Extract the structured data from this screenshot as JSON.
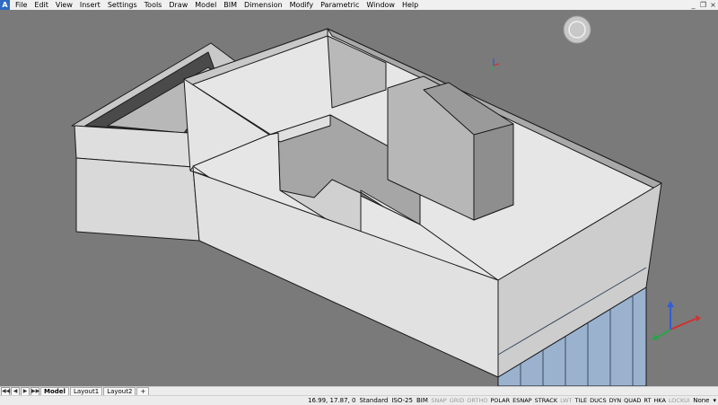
{
  "app": {
    "logo_glyph": "A"
  },
  "menubar": {
    "items": [
      "File",
      "Edit",
      "View",
      "Insert",
      "Settings",
      "Tools",
      "Draw",
      "Model",
      "BIM",
      "Dimension",
      "Modify",
      "Parametric",
      "Window",
      "Help"
    ],
    "window_controls": {
      "minimize": "_",
      "restore": "❐",
      "close": "×"
    }
  },
  "viewport": {
    "background": "#7a7a7a",
    "navigation_glyphs": {
      "compass": "compass-icon",
      "ucs": "ucs-axis-icon"
    }
  },
  "tabs": {
    "nav": [
      "◀◀",
      "◀",
      "▶",
      "▶▶"
    ],
    "items": [
      "Model",
      "Layout1",
      "Layout2"
    ],
    "active": "Model",
    "add": "+"
  },
  "status": {
    "coords": "16.99, 17.87, 0",
    "text_style": "Standard",
    "dim_style": "ISO-25",
    "bim": "BIM",
    "toggles": [
      {
        "label": "SNAP",
        "on": false
      },
      {
        "label": "GRID",
        "on": false
      },
      {
        "label": "ORTHO",
        "on": false
      },
      {
        "label": "POLAR",
        "on": true
      },
      {
        "label": "ESNAP",
        "on": true
      },
      {
        "label": "STRACK",
        "on": true
      },
      {
        "label": "LWT",
        "on": false
      },
      {
        "label": "TILE",
        "on": true
      },
      {
        "label": "DUCS",
        "on": true
      },
      {
        "label": "DYN",
        "on": true
      },
      {
        "label": "QUAD",
        "on": true
      },
      {
        "label": "RT",
        "on": true
      },
      {
        "label": "HKA",
        "on": true
      },
      {
        "label": "LOCKUI",
        "on": false
      }
    ],
    "annotation": "None"
  }
}
